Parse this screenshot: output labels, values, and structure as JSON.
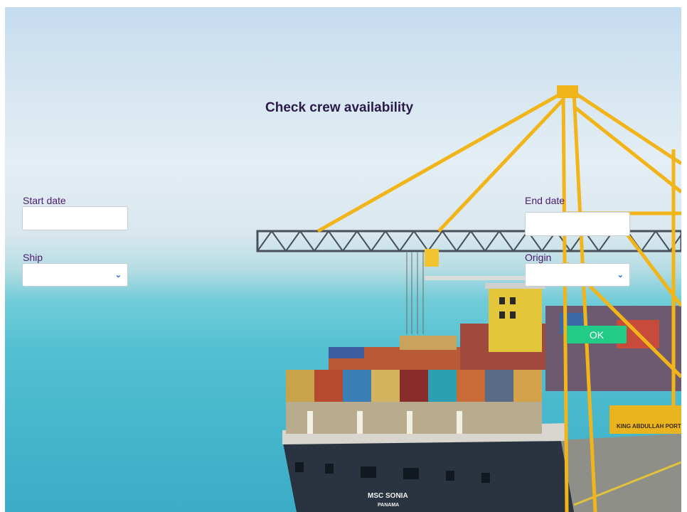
{
  "form": {
    "title": "Check crew availability",
    "start_date": {
      "label": "Start date",
      "value": ""
    },
    "end_date": {
      "label": "End date",
      "value": ""
    },
    "ship": {
      "label": "Ship",
      "selected": ""
    },
    "origin": {
      "label": "Origin",
      "selected": ""
    },
    "submit_label": "OK"
  },
  "background": {
    "ship_name": "MSC SONIA",
    "ship_registry": "PANAMA",
    "port_sign": "KING ABDULLAH PORT"
  },
  "colors": {
    "title": "#2b1a4a",
    "label": "#4c1a6e",
    "ok_button": "#22cc88",
    "chevron": "#2a6fd4"
  }
}
